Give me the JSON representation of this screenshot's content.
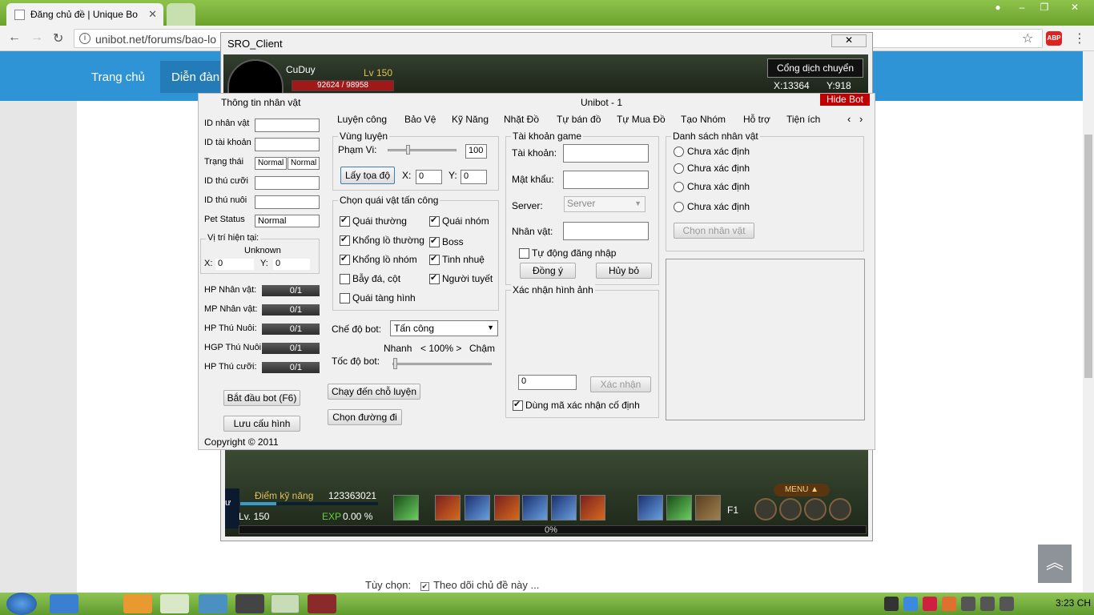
{
  "browser": {
    "tab_title": "Đăng chủ đề | Unique Bo",
    "url": "unibot.net/forums/bao-lo",
    "abp": "ABP"
  },
  "site": {
    "nav_home": "Trang chủ",
    "nav_forum": "Diễn đàn",
    "option_label": "Tùy chọn:",
    "option_watch": "Theo dõi chủ đề này ..."
  },
  "sro": {
    "title": "SRO_Client",
    "char_name": "CuDuy",
    "level": "Lv 150",
    "hp": "92624 / 98958",
    "teleport": "Cổng dịch chuyển",
    "coord_x": "X:13364",
    "coord_y": "Y:918",
    "skill_points_label": "Điểm kỹ năng",
    "skill_points": "123363021",
    "level_bottom": "Lv. 150",
    "exp_label": "EXP",
    "exp_value": "0.00 %",
    "exp_bar_pct": "0%",
    "menu": "MENU ▲",
    "f_key": "F1",
    "side_text": "ư"
  },
  "unibot": {
    "title": "Unibot - 1",
    "hide_bot": "Hide Bot",
    "left_header": "Thông tin nhân vật",
    "fields": {
      "char_id": "ID nhân vật",
      "account_id": "ID tài khoản",
      "status": "Trạng thái",
      "status_val1": "Normal",
      "status_val2": "Normal",
      "mount_id": "ID thú cưỡi",
      "pet_id": "ID thú nuôi",
      "pet_status": "Pet Status",
      "pet_status_val": "Normal"
    },
    "position": {
      "label": "Vị trí hiện tại:",
      "place": "Unknown",
      "x_label": "X:",
      "x_val": "0",
      "y_label": "Y:",
      "y_val": "0"
    },
    "bars": [
      {
        "label": "HP Nhân vật:",
        "value": "0/1"
      },
      {
        "label": "MP Nhân vật:",
        "value": "0/1"
      },
      {
        "label": "HP Thú Nuôi:",
        "value": "0/1"
      },
      {
        "label": "HGP Thú Nuôi:",
        "value": "0/1"
      },
      {
        "label": "HP Thú cưỡi:",
        "value": "0/1"
      }
    ],
    "start_btn": "Bắt đầu bot (F6)",
    "save_btn": "Lưu cấu hình",
    "copyright": "Copyright © 2011",
    "tabs": [
      "Luyện công",
      "Bảo Vệ",
      "Kỹ Năng",
      "Nhặt Đồ",
      "Tự bán đồ",
      "Tự Mua Đồ",
      "Tạo Nhóm",
      "Hỗ trợ",
      "Tiện ích"
    ],
    "training_area": {
      "label": "Vùng luyện",
      "range_label": "Phạm Vi:",
      "range_val": "100",
      "get_coords": "Lấy tọa độ",
      "x_label": "X:",
      "x_val": "0",
      "y_label": "Y:",
      "y_val": "0"
    },
    "monsters": {
      "label": "Chọn quái vật tấn công",
      "normal": "Quái thường",
      "party": "Quái nhóm",
      "giant_normal": "Khổng lồ thường",
      "boss": "Boss",
      "giant_party": "Khổng lồ nhóm",
      "elite": "Tinh nhuệ",
      "trap": "Bẫy đá, cột",
      "snowman": "Người tuyết",
      "invisible": "Quái tàng hình"
    },
    "mode_label": "Chế độ bot:",
    "mode_value": "Tấn công",
    "speed_fast": "Nhanh",
    "speed_pct": "< 100% >",
    "speed_slow": "Chậm",
    "speed_label": "Tốc độ bot:",
    "go_training": "Chạy đến chỗ luyện",
    "choose_path": "Chọn đường đi",
    "account": {
      "label": "Tài khoản game",
      "account": "Tài khoản:",
      "password": "Mật khẩu:",
      "server": "Server:",
      "server_val": "Server",
      "character": "Nhân vật:",
      "auto_login": "Tự động đăng nhập",
      "ok": "Đồng ý",
      "cancel": "Hủy bỏ"
    },
    "captcha": {
      "label": "Xác nhận hình ảnh",
      "input_val": "0",
      "confirm": "Xác nhận",
      "fixed": "Dùng mã xác nhận cố định"
    },
    "char_list": {
      "label": "Danh sách nhân vật",
      "items": [
        "Chưa xác định",
        "Chưa xác định",
        "Chưa xác định",
        "Chưa xác định"
      ],
      "choose": "Chọn nhân vật"
    }
  },
  "taskbar": {
    "time": "3:23 CH"
  }
}
